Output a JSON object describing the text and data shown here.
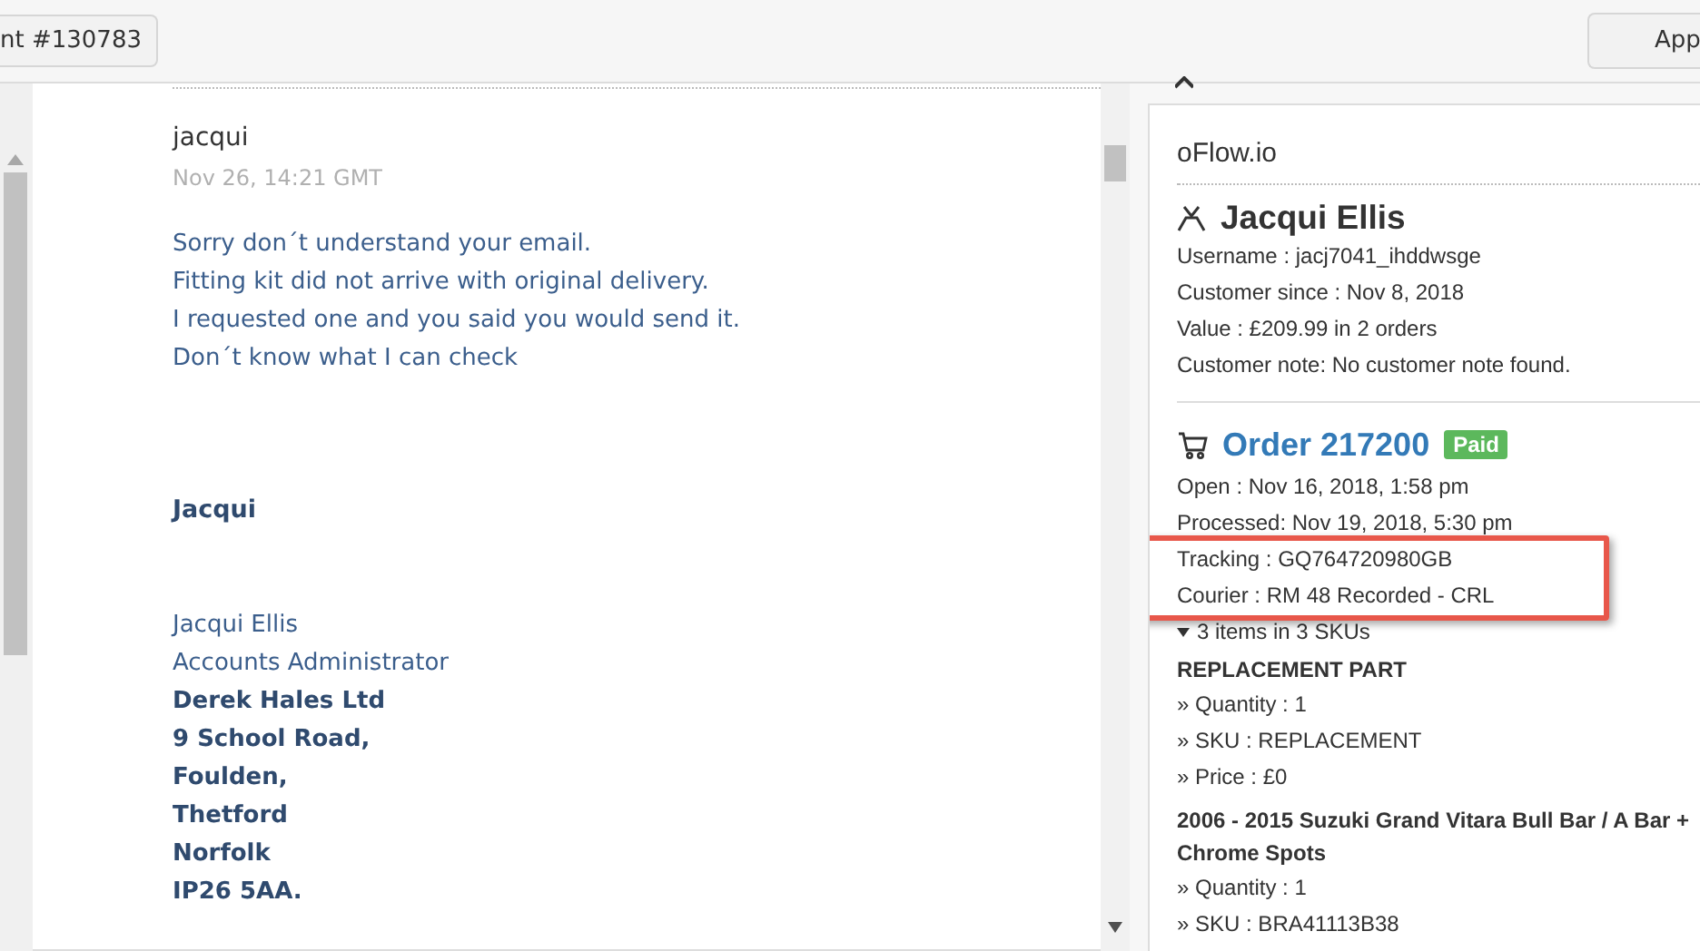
{
  "top_bar": {
    "ticket_button": "nt #130783",
    "right_button": "App"
  },
  "message": {
    "sender": "jacqui",
    "timestamp": "Nov 26, 14:21 GMT",
    "body_lines": [
      "Sorry don´t understand your email.",
      "Fitting kit did not arrive with original delivery.",
      "I requested one and you said you would send it.",
      "Don´t know what I can check"
    ],
    "signoff": "Jacqui",
    "signature": [
      {
        "text": "Jacqui Ellis",
        "bold": false
      },
      {
        "text": "Accounts Administrator",
        "bold": false
      },
      {
        "text": "Derek Hales Ltd",
        "bold": true
      },
      {
        "text": "9 School Road,",
        "bold": true
      },
      {
        "text": "Foulden,",
        "bold": true
      },
      {
        "text": "Thetford",
        "bold": true
      },
      {
        "text": "Norfolk",
        "bold": true
      },
      {
        "text": "IP26 5AA.",
        "bold": true
      }
    ]
  },
  "sidebar": {
    "brand": "oFlow.io",
    "customer": {
      "name": "Jacqui Ellis",
      "details": [
        "Username : jacj7041_ihddwsge",
        "Customer since : Nov 8, 2018",
        "Value : £209.99 in 2 orders",
        "Customer note: No customer note found."
      ]
    },
    "order": {
      "title": "Order 217200",
      "status": "Paid",
      "details": [
        "Open : Nov 16, 2018, 1:58 pm",
        "Processed: Nov 19, 2018, 5:30 pm"
      ],
      "highlighted": [
        "Tracking : GQ764720980GB",
        "Courier : RM 48 Recorded - CRL"
      ],
      "items_toggle": {
        "label": "3 items in 3 SKUs",
        "expanded": true
      },
      "items": [
        {
          "name": "REPLACEMENT PART",
          "details": [
            "» Quantity : 1",
            "» SKU : REPLACEMENT",
            "» Price : £0"
          ]
        },
        {
          "name": "2006 - 2015 Suzuki Grand Vitara Bull Bar / A Bar + Chrome Spots",
          "details": [
            "» Quantity : 1",
            "» SKU : BRA41113B38"
          ]
        }
      ]
    }
  }
}
